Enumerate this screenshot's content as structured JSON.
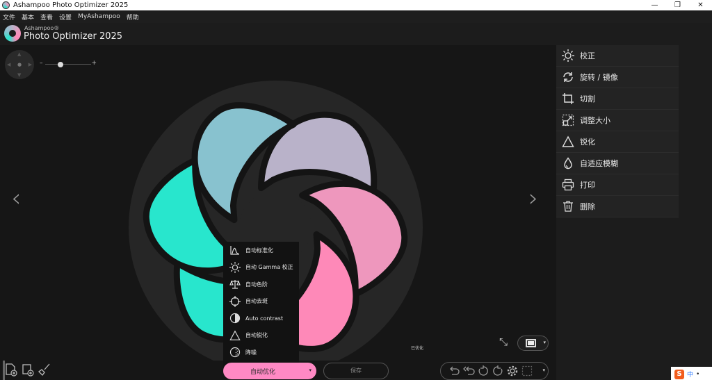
{
  "window": {
    "title": "Ashampoo Photo Optimizer 2025",
    "controls": {
      "minimize": "—",
      "maximize": "❐",
      "close": "✕"
    }
  },
  "menu": [
    "文件",
    "基本",
    "查看",
    "设置",
    "MyAshampoo",
    "帮助"
  ],
  "branding": {
    "brand": "Ashampoo®",
    "product": "Photo Optimizer 2025"
  },
  "viewer": {
    "zoom_minus": "–",
    "zoom_plus": "+",
    "zoom_level": 0.38,
    "prev_arrow": "‹",
    "next_arrow": "›",
    "status": "已优化"
  },
  "tools": [
    {
      "label": "校正",
      "icon": "sun-icon"
    },
    {
      "label": "旋转 / 镜像",
      "icon": "rotate-icon"
    },
    {
      "label": "切割",
      "icon": "crop-icon"
    },
    {
      "label": "调整大小",
      "icon": "resize-icon"
    },
    {
      "label": "锐化",
      "icon": "triangle-icon"
    },
    {
      "label": "自适应模糊",
      "icon": "drop-icon"
    },
    {
      "label": "打印",
      "icon": "printer-icon"
    },
    {
      "label": "删除",
      "icon": "trash-icon"
    }
  ],
  "auto_menu": [
    {
      "label": "自动标准化",
      "icon": "histogram-icon"
    },
    {
      "label": "自动 Gamma 校正",
      "icon": "sun-icon"
    },
    {
      "label": "自动色阶",
      "icon": "scale-icon"
    },
    {
      "label": "自动去斑",
      "icon": "target-icon"
    },
    {
      "label": "Auto contrast",
      "icon": "contrast-icon"
    },
    {
      "label": "自动锐化",
      "icon": "triangle-icon"
    },
    {
      "label": "降噪",
      "icon": "noise-icon"
    }
  ],
  "bottom": {
    "auto_optimize": "自动优化",
    "save": "保存",
    "dropdown_caret": "▾"
  },
  "ime": {
    "lang": "中",
    "punct": "•"
  },
  "colors": {
    "accent_pink": "#ff89c4",
    "petal_lilac": "#b9b2c9",
    "petal_pink": "#ee97bd",
    "petal_hotpink": "#fe89b8",
    "petal_teal": "#28e6cd",
    "petal_blue": "#88c2cf"
  }
}
